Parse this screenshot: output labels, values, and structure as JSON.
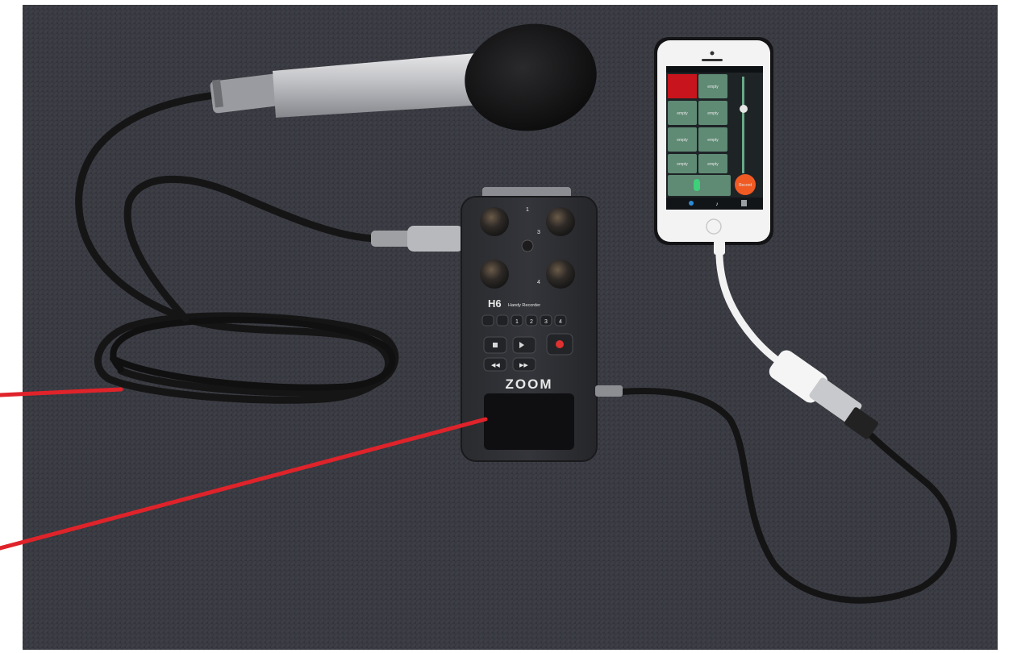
{
  "recorder": {
    "brand": "ZOOM",
    "model": "H6",
    "subtitle": "Handy Recorder",
    "channel_labels": [
      "1",
      "2",
      "3",
      "4"
    ],
    "knob_numbers": [
      "1",
      "2",
      "3",
      "4"
    ],
    "transport_buttons": [
      "stop",
      "play-pause",
      "record",
      "rewind",
      "fast-forward"
    ]
  },
  "phone": {
    "pads": [
      "empty",
      "empty",
      "empty",
      "empty",
      "empty",
      "empty",
      "empty",
      "empty"
    ],
    "record_label": "Record",
    "accent_color": "#f05a23",
    "pad_color": "#5f8a74",
    "header_color": "#c8141c"
  },
  "annotations": {
    "line_color": "#e0232a",
    "count": 2
  },
  "colors": {
    "background": "#3a3b42",
    "frame": "#ffffff",
    "cable": "#141414",
    "white_cable": "#f2f2f2"
  }
}
